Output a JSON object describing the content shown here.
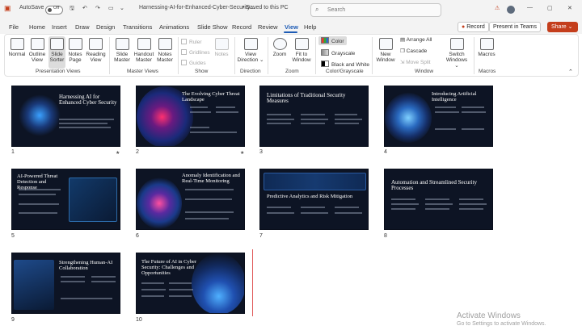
{
  "titlebar": {
    "autosave": "AutoSave",
    "toggle": "Off",
    "doc_title": "Harnessing-AI-for-Enhanced-Cyber-Security....",
    "save_state": "Saved to this PC",
    "search_placeholder": "Search"
  },
  "menus": [
    "File",
    "Home",
    "Insert",
    "Draw",
    "Design",
    "Transitions",
    "Animations",
    "Slide Show",
    "Record",
    "Review",
    "View",
    "Help"
  ],
  "record_label": "Record",
  "present_label": "Present in Teams",
  "share_label": "Share",
  "ribbon": {
    "presentation_views": {
      "group": "Presentation Views",
      "buttons": [
        "Normal",
        "Outline View",
        "Slide Sorter",
        "Notes Page",
        "Reading View"
      ]
    },
    "master_views": {
      "group": "Master Views",
      "buttons": [
        "Slide Master",
        "Handout Master",
        "Notes Master"
      ]
    },
    "show": {
      "group": "Show",
      "items": [
        "Ruler",
        "Gridlines",
        "Guides"
      ],
      "notes": "Notes"
    },
    "direction": {
      "group": "Direction",
      "button": "View Direction"
    },
    "zoom": {
      "group": "Zoom",
      "buttons": [
        "Zoom",
        "Fit to Window"
      ]
    },
    "color": {
      "group": "Color/Grayscale",
      "items": [
        "Color",
        "Grayscale",
        "Black and White"
      ]
    },
    "window": {
      "group": "Window",
      "new_window": "New Window",
      "items": [
        "Arrange All",
        "Cascade",
        "Move Split"
      ],
      "switch": "Switch Windows"
    },
    "macros": {
      "group": "Macros",
      "button": "Macros"
    }
  },
  "slides": [
    {
      "n": "1",
      "title": "Harnessing AI for Enhanced Cyber Security",
      "star": "★"
    },
    {
      "n": "2",
      "title": "The Evolving Cyber Threat Landscape",
      "star": "★"
    },
    {
      "n": "3",
      "title": "Limitations of Traditional Security Measures",
      "star": ""
    },
    {
      "n": "4",
      "title": "Introducing Artificial Intelligence",
      "star": ""
    },
    {
      "n": "5",
      "title": "AI-Powered Threat Detection and Response",
      "star": ""
    },
    {
      "n": "6",
      "title": "Anomaly Identification and Real-Time Monitoring",
      "star": ""
    },
    {
      "n": "7",
      "title": "Predictive Analytics and Risk Mitigation",
      "star": ""
    },
    {
      "n": "8",
      "title": "Automation and Streamlined Security Processes",
      "star": ""
    },
    {
      "n": "9",
      "title": "Strengthening Human-AI Collaboration",
      "star": ""
    },
    {
      "n": "10",
      "title": "The Future of AI in Cyber Security: Challenges and Opportunities",
      "star": ""
    }
  ],
  "watermark": {
    "line1": "Activate Windows",
    "line2": "Go to Settings to activate Windows."
  }
}
